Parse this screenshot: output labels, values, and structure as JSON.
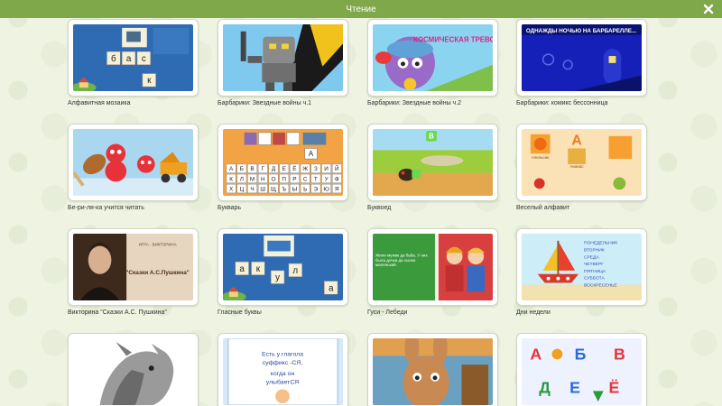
{
  "window": {
    "title": "Чтение",
    "close_icon": "close-icon"
  },
  "colors": {
    "titlebar": "#7ea84a",
    "background": "#eef3e1"
  },
  "games": [
    {
      "title": "Алфавитная мозаика",
      "tiles": [
        "б",
        "а",
        "с",
        "к"
      ]
    },
    {
      "title": "Барбарики: Звездные войны ч.1"
    },
    {
      "title": "Барбарики: Звездные войны ч.2",
      "banner": "КОСМИЧЕСКАЯ ТРЕВОГА!"
    },
    {
      "title": "Барбарики: комикс бессонница",
      "banner": "ОДНАЖДЫ НОЧЬЮ НА БАРБАРЕЛЛЕ..."
    },
    {
      "title": "Бе-ри-ля-ка учится читать"
    },
    {
      "title": "Букварь",
      "rows": [
        [
          "А",
          "Б",
          "В",
          "Г",
          "Д",
          "Е",
          "Ё",
          "Ж",
          "З",
          "И",
          "Й"
        ],
        [
          "К",
          "Л",
          "М",
          "Н",
          "О",
          "П",
          "Р",
          "С",
          "Т",
          "У",
          "Ф"
        ],
        [
          "Х",
          "Ц",
          "Ч",
          "Ш",
          "Щ",
          "Ъ",
          "Ы",
          "Ь",
          "Э",
          "Ю",
          "Я"
        ]
      ],
      "answer": "А"
    },
    {
      "title": "Буквоед",
      "letter": "В"
    },
    {
      "title": "Веселый алфавит",
      "letter": "А",
      "words": [
        "Апельсин",
        "Ананас"
      ]
    },
    {
      "title": "Викторина \"Сказки А.С. Пушкина\"",
      "quiz_label": "ИГРА - ВИКТОРИНА",
      "quiz_text": "\"Сказки А.С.Пушкина\""
    },
    {
      "title": "Гласные буквы",
      "tiles": [
        "а",
        "к",
        "у",
        "л",
        "а"
      ]
    },
    {
      "title": "Гуси - Лебеди",
      "story_text": "Жили мужик да баба. У них была дочка да сынок маленький."
    },
    {
      "title": "Дни недели",
      "days": [
        "ПОНЕДЕЛЬНИК",
        "ВТОРНИК",
        "СРЕДА",
        "ЧЕТВЕРГ",
        "ПЯТНИЦА",
        "СУББОТА",
        "ВОСКРЕСЕНЬЕ"
      ]
    },
    {
      "title": ""
    },
    {
      "title": "",
      "suffix_text": [
        "Есть у глагола",
        "суффикс -СЯ,",
        "когда он",
        "улыбаетСЯ"
      ]
    },
    {
      "title": ""
    },
    {
      "title": "",
      "letters": [
        "А",
        "Б",
        "В",
        "Д",
        "Е",
        "Ё"
      ]
    }
  ]
}
